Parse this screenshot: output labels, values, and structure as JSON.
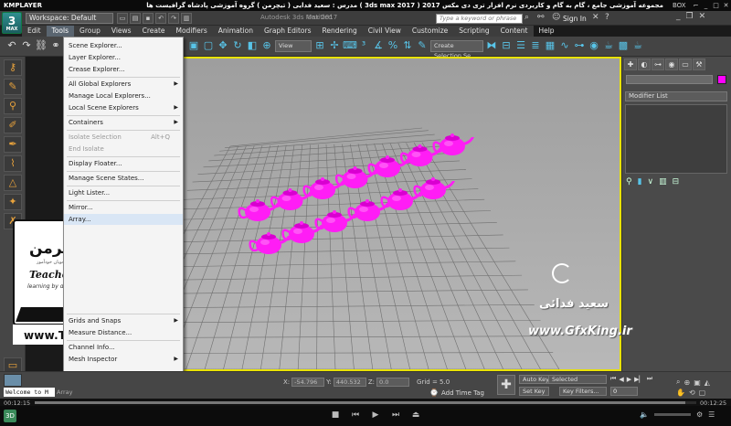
{
  "player": {
    "brand": "KMPLAYER",
    "title_text": "مجموعه آموزشی جامع ، گام به گام و کاربردی نرم افزار تری دی مکس 2017 ( 3ds max 2017 ) مدرس : سعید فدایی ( تیچرمن ) گروه آموزشی پادشاه گرافیست ها",
    "right_label": "BOX",
    "elapsed": "00:12:15",
    "total": "00:12:25"
  },
  "app": {
    "logo_number": "3",
    "logo_label": "MAX",
    "workspace": "Workspace: Default",
    "doc_title": "Autodesk 3ds Max 2017",
    "doc_title2": "Untitled",
    "search_placeholder": "Type a keyword or phrase",
    "sign_in": "Sign In"
  },
  "menubar": {
    "items": [
      "Edit",
      "Tools",
      "Group",
      "Views",
      "Create",
      "Modifiers",
      "Animation",
      "Graph Editors",
      "Rendering",
      "Civil View",
      "Customize",
      "Scripting",
      "Content",
      "Help"
    ],
    "active": "Tools"
  },
  "toolbar": {
    "view_dropdown": "View",
    "selection_set": "Create Selection Se"
  },
  "tools_menu": {
    "items": [
      {
        "label": "Scene Explorer...",
        "disabled": false,
        "submenu": false,
        "shortcut": ""
      },
      {
        "label": "Layer Explorer...",
        "disabled": false,
        "submenu": false,
        "shortcut": ""
      },
      {
        "label": "Crease Explorer...",
        "disabled": false,
        "submenu": false,
        "shortcut": ""
      },
      {
        "label": "All Global Explorers",
        "disabled": false,
        "submenu": true,
        "shortcut": ""
      },
      {
        "label": "Manage Local Explorers...",
        "disabled": false,
        "submenu": false,
        "shortcut": ""
      },
      {
        "label": "Local Scene Explorers",
        "disabled": false,
        "submenu": true,
        "shortcut": ""
      },
      {
        "label": "Containers",
        "disabled": false,
        "submenu": true,
        "shortcut": ""
      },
      {
        "label": "Isolate Selection",
        "disabled": true,
        "submenu": false,
        "shortcut": "Alt+Q"
      },
      {
        "label": "End Isolate",
        "disabled": true,
        "submenu": false,
        "shortcut": ""
      },
      {
        "label": "Display Floater...",
        "disabled": false,
        "submenu": false,
        "shortcut": ""
      },
      {
        "label": "Manage Scene States...",
        "disabled": false,
        "submenu": false,
        "shortcut": ""
      },
      {
        "label": "Light Lister...",
        "disabled": false,
        "submenu": false,
        "shortcut": ""
      },
      {
        "label": "Mirror...",
        "disabled": false,
        "submenu": false,
        "shortcut": ""
      },
      {
        "label": "Array...",
        "disabled": false,
        "submenu": false,
        "shortcut": ""
      },
      {
        "label": "Grids and Snaps",
        "disabled": false,
        "submenu": true,
        "shortcut": ""
      },
      {
        "label": "Measure Distance...",
        "disabled": false,
        "submenu": false,
        "shortcut": ""
      },
      {
        "label": "Channel Info...",
        "disabled": false,
        "submenu": false,
        "shortcut": ""
      },
      {
        "label": "Mesh Inspector",
        "disabled": false,
        "submenu": true,
        "shortcut": ""
      }
    ]
  },
  "right_panel": {
    "modifier_list": "Modifier List"
  },
  "status": {
    "x_label": "X:",
    "x_value": "-54.796",
    "y_label": "Y:",
    "y_value": "440.532",
    "z_label": "Z:",
    "z_value": "0.0",
    "grid": "Grid = 5.0",
    "add_time_tag": "Add Time Tag",
    "auto_key": "Auto Key",
    "selected": "Selected",
    "set_key": "Set Key",
    "key_filters": "Key Filters...",
    "frame_value": "0",
    "maxscript": "Welcome to M",
    "array_label": "Array"
  },
  "overlay": {
    "brand_fa": "تیچرمن",
    "brand_fa_sub": "دانشجویان خودآموز",
    "name": "Teacher Man",
    "sub": "learning by doing",
    "url": "www.TeacherMan.ir",
    "watermark_fa": "سعید فدائی",
    "watermark_url": "www.GfxKing.ir"
  },
  "colors": {
    "teapot": "#ff1df5",
    "viewport_border": "#e8e200",
    "viewport_bg": "#a7a7a7"
  }
}
